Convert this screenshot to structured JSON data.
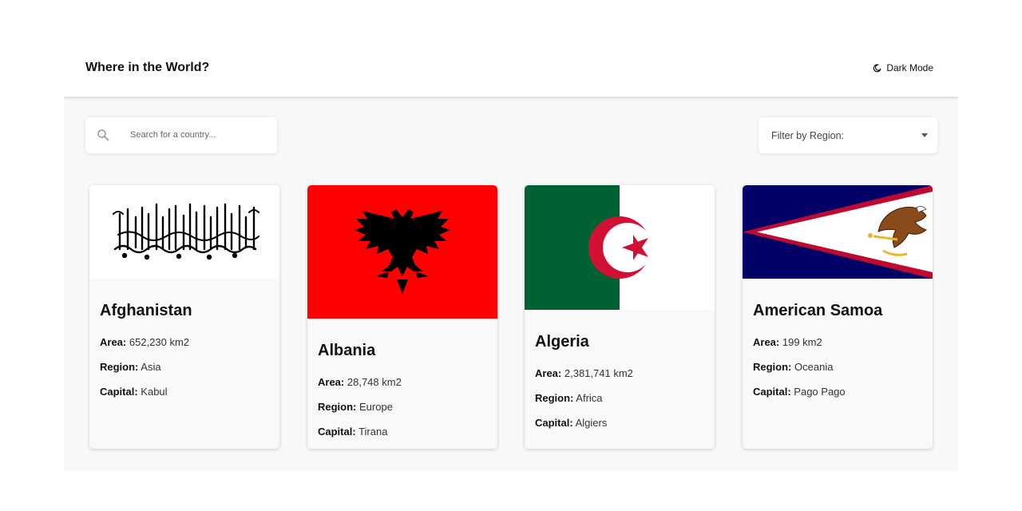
{
  "header": {
    "title": "Where in the World?",
    "dark_mode_label": "Dark Mode",
    "dark_mode_icon": "moon-icon"
  },
  "search": {
    "placeholder": "Search for a country...",
    "value": "",
    "icon": "search-icon"
  },
  "filter": {
    "label": "Filter by Region:",
    "icon": "caret-down-icon"
  },
  "labels": {
    "area": "Area:",
    "region": "Region:",
    "capital": "Capital:"
  },
  "countries": [
    {
      "name": "Afghanistan",
      "area": "652,230 km2",
      "region": "Asia",
      "capital": "Kabul",
      "flag": "afghanistan-flag"
    },
    {
      "name": "Albania",
      "area": "28,748 km2",
      "region": "Europe",
      "capital": "Tirana",
      "flag": "albania-flag"
    },
    {
      "name": "Algeria",
      "area": "2,381,741 km2",
      "region": "Africa",
      "capital": "Algiers",
      "flag": "algeria-flag"
    },
    {
      "name": "American Samoa",
      "area": "199 km2",
      "region": "Oceania",
      "capital": "Pago Pago",
      "flag": "american-samoa-flag"
    }
  ],
  "colors": {
    "background": "#f8f8f8",
    "card": "#f9f9f9",
    "albania_red": "#ff0000",
    "algeria_green": "#006233",
    "algeria_red": "#d21034",
    "samoa_navy": "#000066",
    "samoa_red": "#bf0a30"
  }
}
